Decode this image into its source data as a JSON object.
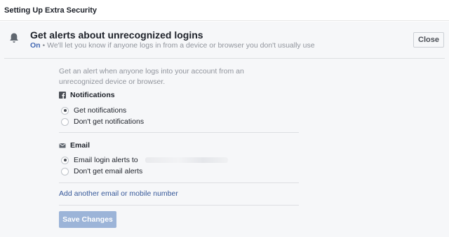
{
  "header": {
    "title": "Setting Up Extra Security"
  },
  "alerts_section": {
    "title": "Get alerts about unrecognized logins",
    "status": "On",
    "description": " • We'll let you know if anyone logs in from a device or browser you don't usually use",
    "close_label": "Close",
    "intro": "Get an alert when anyone logs into your account from an unrecognized device or browser."
  },
  "notifications": {
    "heading": "Notifications",
    "options": [
      {
        "label": "Get notifications",
        "checked": true
      },
      {
        "label": "Don't get notifications",
        "checked": false
      }
    ]
  },
  "email": {
    "heading": "Email",
    "options": [
      {
        "label": "Email login alerts to",
        "checked": true
      },
      {
        "label": "Don't get email alerts",
        "checked": false
      }
    ]
  },
  "add_link": "Add another email or mobile number",
  "save_label": "Save Changes",
  "colors": {
    "link": "#365899",
    "status_on": "#4267b2",
    "save_disabled": "#9cb4d8"
  }
}
